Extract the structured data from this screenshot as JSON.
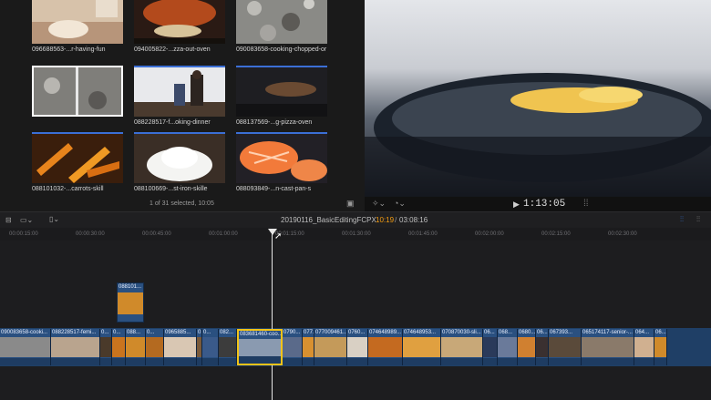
{
  "browser": {
    "clips": [
      {
        "name": "096688563-...r-having-fun",
        "thumb": "dough-hands"
      },
      {
        "name": "094005822-...zza-out-oven",
        "thumb": "pizza-oven"
      },
      {
        "name": "090083658-cooking-chopped-or",
        "thumb": "granite"
      },
      {
        "name": "",
        "thumb": "granite-split"
      },
      {
        "name": "088228517-f...oking-dinner",
        "thumb": "kitchen-people"
      },
      {
        "name": "088137569-...g-pizza-oven",
        "thumb": "dark-oven"
      },
      {
        "name": "088101032-...carrots-skill",
        "thumb": "carrots"
      },
      {
        "name": "088100669-...st-iron-skille",
        "thumb": "flour"
      },
      {
        "name": "088093849-...n-cast-pan-s",
        "thumb": "salmon"
      }
    ],
    "footer_status": "1 of 31 selected, 10:05"
  },
  "viewer": {
    "timecode": "00:00:01:13:05",
    "timecode_display": "1:13:05"
  },
  "timeline": {
    "project_name": "20190116_BasicEditingFCPX",
    "position": "10:19",
    "duration": "03:08:16",
    "ruler": [
      "00:00:15:00",
      "00:00:30:00",
      "00:00:45:00",
      "00:01:00:00",
      "00:01:15:00",
      "00:01:30:00",
      "00:01:45:00",
      "00:02:00:00",
      "00:02:15:00",
      "00:02:30:00"
    ],
    "connected_clip_label": "088101...",
    "primary_clips": [
      {
        "label": "090083658-cooki...",
        "w": 56,
        "c": "#8a8a8a"
      },
      {
        "label": "088228517-femi...",
        "w": 54,
        "c": "#b9a48e"
      },
      {
        "label": "0...",
        "w": 13,
        "c": "#4a3a2a"
      },
      {
        "label": "0...",
        "w": 15,
        "c": "#c9741e"
      },
      {
        "label": "088...",
        "w": 22,
        "c": "#d08a2a"
      },
      {
        "label": "0...",
        "w": 20,
        "c": "#b46a20"
      },
      {
        "label": "0965885...",
        "w": 36,
        "c": "#d9c7b3"
      },
      {
        "label": "0...",
        "w": 6,
        "c": "#7a5a3a"
      },
      {
        "label": "0...",
        "w": 18,
        "c": "#3a5a8a"
      },
      {
        "label": "082...",
        "w": 20,
        "c": "#3c3c3c"
      },
      {
        "label": "083681460-coo...",
        "w": 50,
        "c": "#8a9ab0"
      },
      {
        "label": "0790...",
        "w": 22,
        "c": "#5a6a8a"
      },
      {
        "label": "077...",
        "w": 13,
        "c": "#d89030"
      },
      {
        "label": "077009461...",
        "w": 36,
        "c": "#c49a5a"
      },
      {
        "label": "0760...",
        "w": 23,
        "c": "#d9d0c4"
      },
      {
        "label": "074648989...",
        "w": 38,
        "c": "#c46a20"
      },
      {
        "label": "074648953...",
        "w": 42,
        "c": "#e0a040"
      },
      {
        "label": "070870030-sli...",
        "w": 46,
        "c": "#c8a878"
      },
      {
        "label": "06...",
        "w": 16,
        "c": "#2a3a5a"
      },
      {
        "label": "068...",
        "w": 22,
        "c": "#6a7a9a"
      },
      {
        "label": "0680...",
        "w": 20,
        "c": "#d08030"
      },
      {
        "label": "06...",
        "w": 14,
        "c": "#3a3030"
      },
      {
        "label": "067393...",
        "w": 36,
        "c": "#5a4a3a"
      },
      {
        "label": "065174117-senior-...",
        "w": 58,
        "c": "#8a7a6a"
      },
      {
        "label": "064...",
        "w": 22,
        "c": "#d0b090"
      },
      {
        "label": "06...",
        "w": 14,
        "c": "#d08a2a"
      }
    ]
  },
  "colors": {
    "accent": "#3b6fd6",
    "playhead": "#e6e6e6",
    "clip_fill": "#2a5080",
    "selection": "#f2c318",
    "timecode_orange": "#f39c12"
  }
}
